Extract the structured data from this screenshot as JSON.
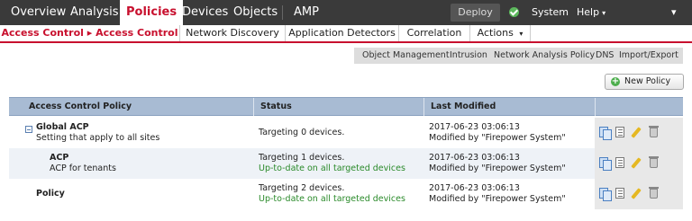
{
  "topnav": {
    "items": [
      "Overview",
      "Analysis",
      "Policies",
      "Devices",
      "Objects",
      "AMP"
    ],
    "active": "Policies",
    "deploy_label": "Deploy",
    "system_label": "System",
    "help_label": "Help",
    "caret": "▾"
  },
  "subtabs": {
    "items": [
      "Access Control ▸ Access Control",
      "Network Discovery",
      "Application Detectors",
      "Correlation",
      "Actions"
    ],
    "active_index": 0,
    "actions_caret": "▾"
  },
  "links": [
    "Object Management",
    "Intrusion",
    "Network Analysis Policy",
    "DNS",
    "Import/Export"
  ],
  "new_policy_label": "New Policy",
  "table": {
    "columns": [
      "Access Control Policy",
      "Status",
      "Last Modified"
    ],
    "rows": [
      {
        "name": "Global ACP",
        "desc": "Setting that apply to all sites",
        "status1": "Targeting 0 devices.",
        "status2": "",
        "modified": "2017-06-23 03:06:13",
        "modified_by": "Modified by \"Firepower System\""
      },
      {
        "name": "ACP",
        "desc": "ACP for tenants",
        "status1": "Targeting 1 devices.",
        "status2": "Up-to-date on all targeted devices",
        "modified": "2017-06-23 03:06:13",
        "modified_by": "Modified by \"Firepower System\""
      },
      {
        "name": "Policy",
        "desc": "",
        "status1": "Targeting 2 devices.",
        "status2": "Up-to-date on all targeted devices",
        "modified": "2017-06-23 03:06:13",
        "modified_by": "Modified by \"Firepower System\""
      }
    ]
  },
  "colors": {
    "nav_bg": "#3a3a3a",
    "accent_red": "#c8102e",
    "header_blue": "#a8bbd3",
    "status_green": "#2a8a2a"
  }
}
